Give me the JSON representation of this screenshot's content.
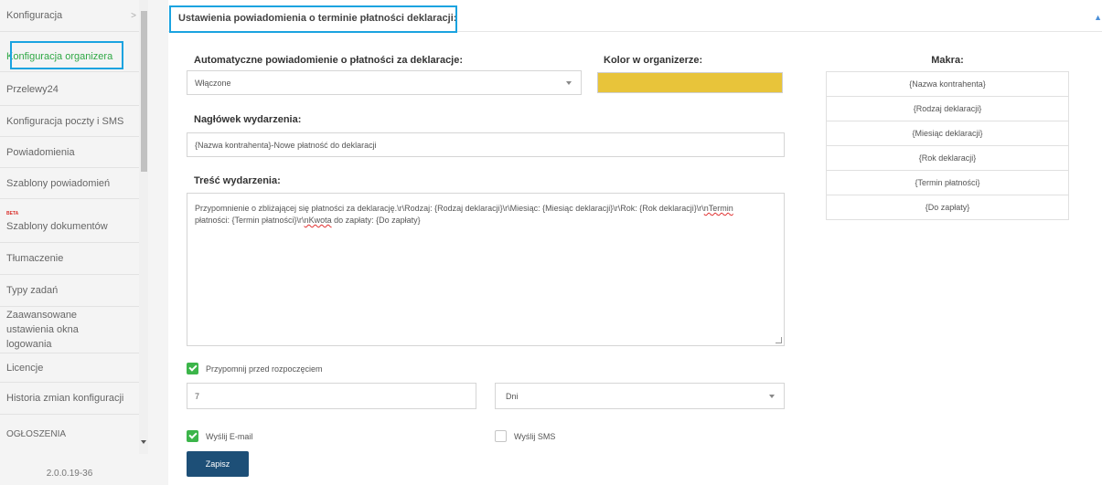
{
  "sidebar": {
    "items": [
      {
        "label": "Konfiguracja",
        "has_chevron": true
      },
      {
        "label": "Konfiguracja organizera",
        "active": true
      },
      {
        "label": "Przelewy24"
      },
      {
        "label": "Konfiguracja poczty i SMS"
      },
      {
        "label": "Powiadomienia"
      },
      {
        "label": "Szablony powiadomień"
      },
      {
        "label": "Szablony dokumentów",
        "badge": "BETA"
      },
      {
        "label": "Tłumaczenie"
      },
      {
        "label": "Typy zadań"
      },
      {
        "label": "Zaawansowane ustawienia okna logowania"
      },
      {
        "label": "Licencje"
      },
      {
        "label": "Historia zmian konfiguracji"
      },
      {
        "label": "OGŁOSZENIA"
      }
    ],
    "version": "2.0.0.19-36",
    "chevron_icon": ">"
  },
  "section": {
    "title": "Ustawienia powiadomienia o terminie płatności deklaracji:"
  },
  "form": {
    "auto_label": "Automatyczne powiadomienie o płatności za deklaracje:",
    "auto_value": "Włączone",
    "color_label": "Kolor w organizerze:",
    "color_value": "#e8c43a",
    "header_label": "Nagłówek wydarzenia:",
    "header_value": "{Nazwa kontrahenta}-Nowe płatność do deklaracji",
    "content_label": "Treść wydarzenia:",
    "content_line1": "Przypomnienie o zbliżającej się płatności za deklarację.\\r\\Rodzaj: {Rodzaj deklaracji}\\r\\Miesiąc: {Miesiąc deklaracji}\\r\\Rok: {Rok deklaracji}\\r\\",
    "content_line1_spell": "nTermin",
    "content_line2_a": "płatności: {Termin płatności}\\r\\",
    "content_line2_spell": "nKwota",
    "content_line2_b": " do zapłaty: {Do zapłaty}",
    "remind_label": "Przypomnij przed rozpoczęciem",
    "remind_checked": true,
    "remind_amount": "7",
    "remind_unit": "Dni",
    "send_email_label": "Wyślij E-mail",
    "send_email_checked": true,
    "send_sms_label": "Wyślij SMS",
    "send_sms_checked": false,
    "save_label": "Zapisz"
  },
  "macros": {
    "title": "Makra:",
    "items": [
      "{Nazwa kontrahenta}",
      "{Rodzaj deklaracji}",
      "{Miesiąc deklaracji}",
      "{Rok deklaracji}",
      "{Termin płatności}",
      "{Do zapłaty}"
    ]
  },
  "colors": {
    "accent_green": "#2fa845",
    "highlight_blue": "#1aa3e0",
    "save_button": "#1d4f77",
    "swatch": "#e8c43a"
  }
}
